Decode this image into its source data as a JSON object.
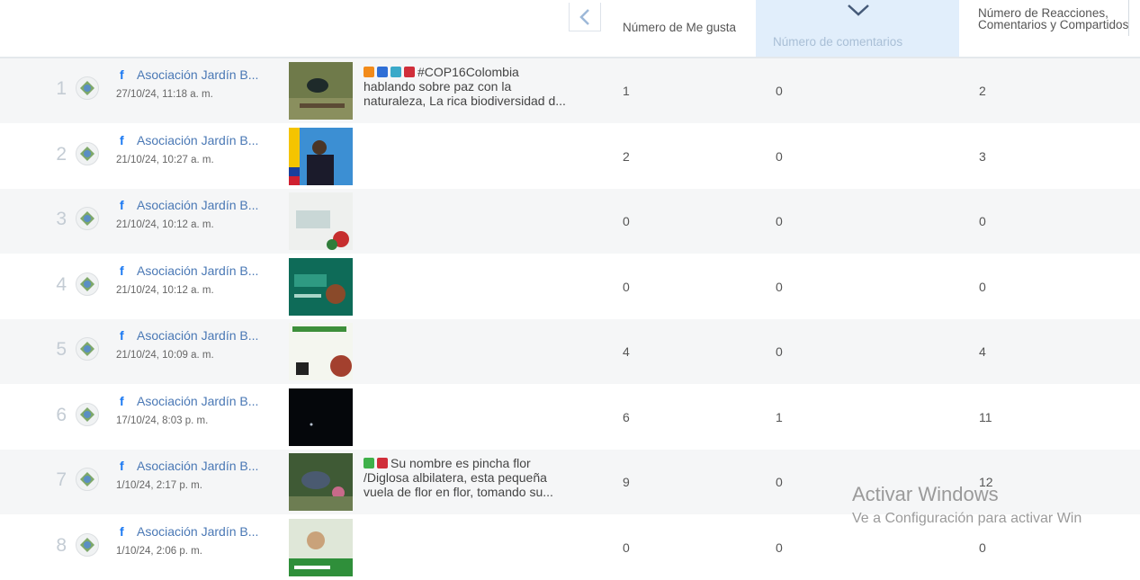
{
  "header": {
    "likes_label": "Número de Me gusta",
    "comments_label": "Número de comentarios",
    "reactions_label": "Número de Reacciones, Comentarios y Compartidos",
    "collapse_icon": "chevron-left-icon",
    "sort_icon": "chevron-down-icon",
    "accent_color": "#e1eefb"
  },
  "rows": [
    {
      "num": "1",
      "author": "Asociación Jardín B...",
      "date": "27/10/24, 11:18 a. m.",
      "caption": [
        "#COP16Colombia",
        "hablando sobre paz con la",
        "naturaleza, La rica biodiversidad d..."
      ],
      "likes": "1",
      "comments": "0",
      "reactions": "2"
    },
    {
      "num": "2",
      "author": "Asociación Jardín B...",
      "date": "21/10/24, 10:27 a. m.",
      "caption": [
        "",
        "",
        ""
      ],
      "likes": "2",
      "comments": "0",
      "reactions": "3"
    },
    {
      "num": "3",
      "author": "Asociación Jardín B...",
      "date": "21/10/24, 10:12 a. m.",
      "caption": [
        "",
        "",
        ""
      ],
      "likes": "0",
      "comments": "0",
      "reactions": "0"
    },
    {
      "num": "4",
      "author": "Asociación Jardín B...",
      "date": "21/10/24, 10:12 a. m.",
      "caption": [
        "",
        "",
        ""
      ],
      "likes": "0",
      "comments": "0",
      "reactions": "0"
    },
    {
      "num": "5",
      "author": "Asociación Jardín B...",
      "date": "21/10/24, 10:09 a. m.",
      "caption": [
        "",
        "",
        ""
      ],
      "likes": "4",
      "comments": "0",
      "reactions": "4"
    },
    {
      "num": "6",
      "author": "Asociación Jardín B...",
      "date": "17/10/24, 8:03 p. m.",
      "caption": [
        "",
        "",
        ""
      ],
      "likes": "6",
      "comments": "1",
      "reactions": "11"
    },
    {
      "num": "7",
      "author": "Asociación Jardín B...",
      "date": "1/10/24, 2:17 p. m.",
      "caption": [
        "Su nombre es pincha flor",
        "/Diglosa albilatera, esta pequeña",
        "vuela de flor en flor, tomando su..."
      ],
      "likes": "9",
      "comments": "0",
      "reactions": "12"
    },
    {
      "num": "8",
      "author": "Asociación Jardín B...",
      "date": "1/10/24, 2:06 p. m.",
      "caption": [
        "",
        "",
        ""
      ],
      "likes": "0",
      "comments": "0",
      "reactions": "0"
    }
  ],
  "watermark": {
    "title": "Activar Windows",
    "subtitle": "Ve a Configuración para activar Win"
  }
}
